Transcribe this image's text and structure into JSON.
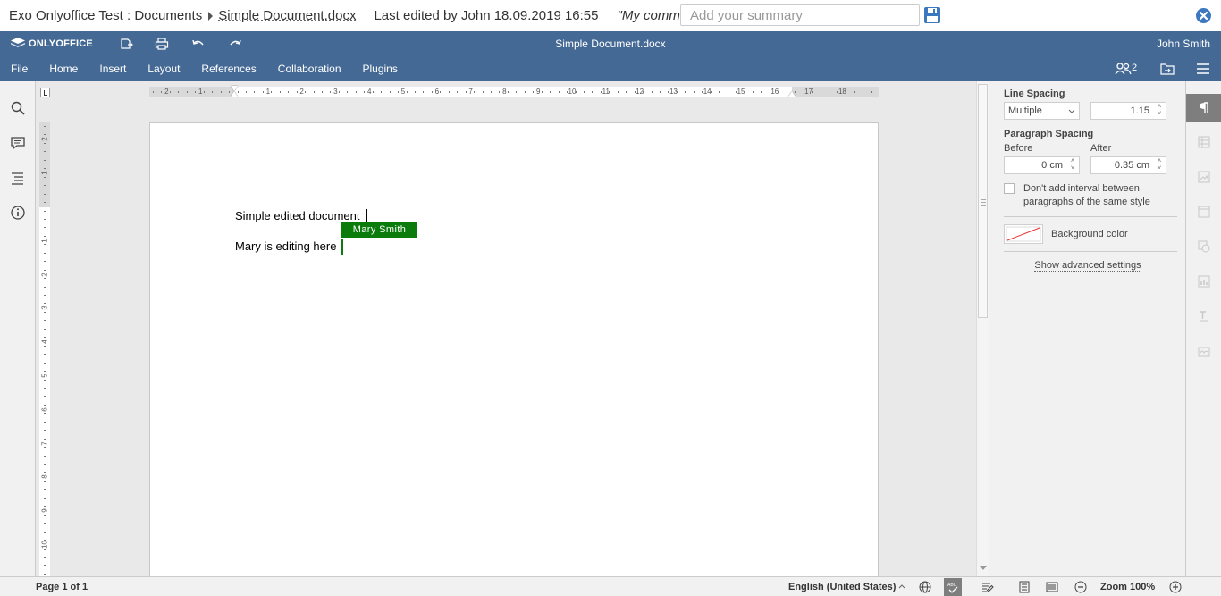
{
  "exo_bar": {
    "breadcrumb": "Exo Onlyoffice Test : Documents",
    "document_name": "Simple Document.docx",
    "last_edited": "Last edited by John 18.09.2019 16:55",
    "comment": "\"My comment\"",
    "summary_placeholder": "Add your summary",
    "icons": {
      "save": "floppy-disk-icon",
      "close": "close-circle-icon"
    }
  },
  "editor_header": {
    "logo_text": "ONLYOFFICE",
    "document_title": "Simple Document.docx",
    "user_name": "John Smith",
    "tabs": [
      "File",
      "Home",
      "Insert",
      "Layout",
      "References",
      "Collaboration",
      "Plugins"
    ],
    "coauthors_count": "2",
    "brand_color": "#446995"
  },
  "document": {
    "line1": "Simple edited document",
    "line2": "Mary is editing here",
    "coauthor_tag": "Mary Smith",
    "coauthor_color": "#0b7b0b"
  },
  "ruler": {
    "horizontal_labels": [
      "2",
      "1",
      "1",
      "2",
      "3",
      "4",
      "5",
      "6",
      "7",
      "8",
      "9",
      "10",
      "11",
      "12",
      "13",
      "14",
      "15",
      "16",
      "17",
      "18"
    ],
    "vertical_labels": [
      "2",
      "1",
      "1",
      "2",
      "3",
      "4",
      "5",
      "6",
      "7",
      "8",
      "9",
      "10"
    ]
  },
  "paragraph_settings": {
    "line_spacing_label": "Line Spacing",
    "line_spacing_mode": "Multiple",
    "line_spacing_value": "1.15",
    "paragraph_spacing_label": "Paragraph Spacing",
    "before_label": "Before",
    "before_value": "0 cm",
    "after_label": "After",
    "after_value": "0.35 cm",
    "checkbox_label_1": "Don't add interval between",
    "checkbox_label_2": "paragraphs of the same style",
    "checkbox_checked": false,
    "background_color_label": "Background color",
    "advanced_link": "Show advanced settings"
  },
  "status_bar": {
    "page_info": "Page 1 of 1",
    "language": "English (United States)",
    "zoom": "Zoom 100%"
  }
}
